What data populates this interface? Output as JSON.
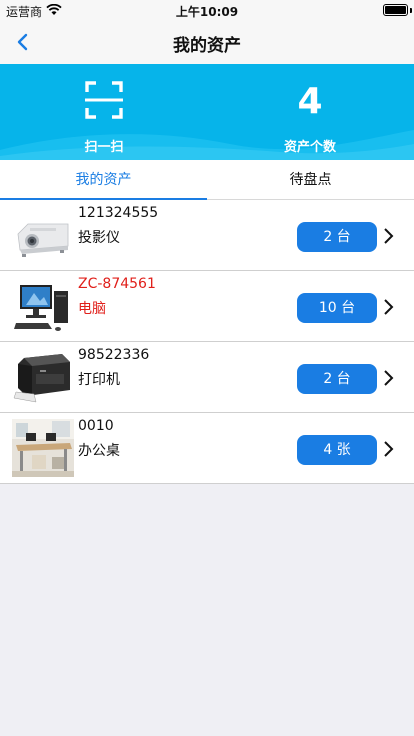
{
  "status_bar": {
    "carrier": "运营商",
    "time": "上午10:09"
  },
  "nav": {
    "title": "我的资产",
    "back_icon": "chevron-left-icon"
  },
  "hero": {
    "scan_label": "扫一扫",
    "scan_icon": "scan-icon",
    "asset_count": "4",
    "asset_count_label": "资产个数",
    "background": "#06b4ea"
  },
  "tabs": [
    {
      "label": "我的资产",
      "active": true
    },
    {
      "label": "待盘点",
      "active": false
    }
  ],
  "accent_color": "#1a7de3",
  "alert_color": "#e0201b",
  "assets": [
    {
      "code": "121324555",
      "name": "投影仪",
      "quantity": "2 台",
      "thumb": "projector",
      "alert": false
    },
    {
      "code": "ZC-874561",
      "name": "电脑",
      "quantity": "10 台",
      "thumb": "computer",
      "alert": true
    },
    {
      "code": "98522336",
      "name": "打印机",
      "quantity": "2 台",
      "thumb": "printer",
      "alert": false
    },
    {
      "code": "0010",
      "name": "办公桌",
      "quantity": "4 张",
      "thumb": "desk",
      "alert": false
    }
  ]
}
